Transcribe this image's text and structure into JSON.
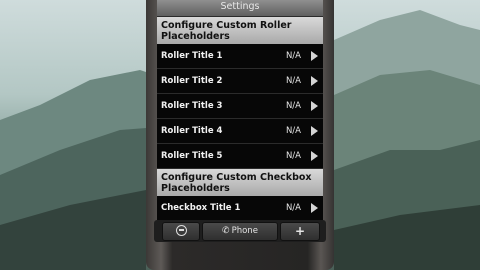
{
  "titlebar": {
    "title": "Settings"
  },
  "sections": [
    {
      "header": "Configure Custom Roller Placeholders",
      "rows": [
        {
          "label": "Roller Title 1",
          "value": "N/A"
        },
        {
          "label": "Roller Title 2",
          "value": "N/A"
        },
        {
          "label": "Roller Title 3",
          "value": "N/A"
        },
        {
          "label": "Roller Title 4",
          "value": "N/A"
        },
        {
          "label": "Roller Title 5",
          "value": "N/A"
        }
      ]
    },
    {
      "header": "Configure Custom Checkbox Placeholders",
      "rows": [
        {
          "label": "Checkbox Title 1",
          "value": "N/A"
        }
      ]
    }
  ],
  "bottombar": {
    "left_icon": "minus-circle-icon",
    "phone_label": "Phone",
    "phone_icon": "handset-icon",
    "add_label": "+"
  },
  "colors": {
    "section_header_bg": "#c4c4c4",
    "list_bg": "#070707",
    "titlebar_bg": "#757575"
  }
}
